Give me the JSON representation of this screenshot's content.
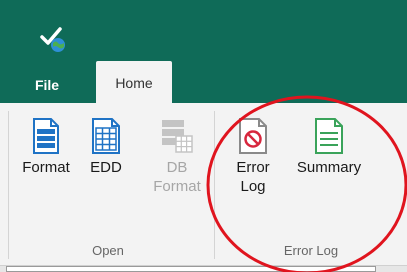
{
  "tabs": {
    "file": "File",
    "home": "Home"
  },
  "ribbon": {
    "groups": [
      {
        "label": "Open",
        "tools": [
          {
            "label": "Format",
            "icon": "format-document-icon",
            "enabled": true
          },
          {
            "label": "EDD",
            "icon": "edd-grid-icon",
            "enabled": true
          },
          {
            "label_line1": "DB",
            "label_line2": "Format",
            "icon": "db-format-icon",
            "enabled": false
          }
        ]
      },
      {
        "label": "Error Log",
        "tools": [
          {
            "label_line1": "Error",
            "label_line2": "Log",
            "icon": "error-log-icon",
            "enabled": true
          },
          {
            "label": "Summary",
            "icon": "summary-document-icon",
            "enabled": true
          }
        ]
      }
    ]
  },
  "colors": {
    "header": "#0f6b58",
    "ribbon": "#f3f3f3",
    "accent_blue": "#1f73c5",
    "accent_green": "#3aa35a",
    "annotation_red": "#e0141e"
  }
}
